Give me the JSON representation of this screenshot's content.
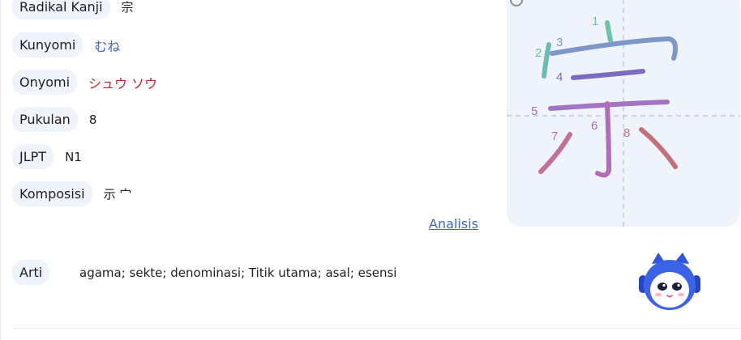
{
  "details": {
    "radical": {
      "label": "Radikal Kanji",
      "value": "宗"
    },
    "kunyomi": {
      "label": "Kunyomi",
      "value": "むね"
    },
    "onyomi": {
      "label": "Onyomi",
      "value": "シュウ ソウ"
    },
    "strokes": {
      "label": "Pukulan",
      "value": "8"
    },
    "jlpt": {
      "label": "JLPT",
      "value": "N1"
    },
    "components": {
      "label": "Komposisi",
      "value": "示 宀"
    }
  },
  "analysis_link": "Analisis",
  "meaning": {
    "label": "Arti",
    "value": "agama; sekte; denominasi; Titik utama; asal; esensi"
  },
  "stroke_order": {
    "numbers": [
      "1",
      "2",
      "3",
      "4",
      "5",
      "6",
      "7",
      "8"
    ],
    "colors": {
      "s1": "#6cc3a6",
      "s2": "#6cbdb0",
      "s3": "#7c97c8",
      "s4": "#7b6cc0",
      "s5": "#a174c4",
      "s6": "#b06cb6",
      "s7": "#c0709a",
      "s8": "#c4707a"
    }
  },
  "icons": {
    "refresh": "refresh-icon",
    "mascot": "robot-mascot-icon"
  }
}
